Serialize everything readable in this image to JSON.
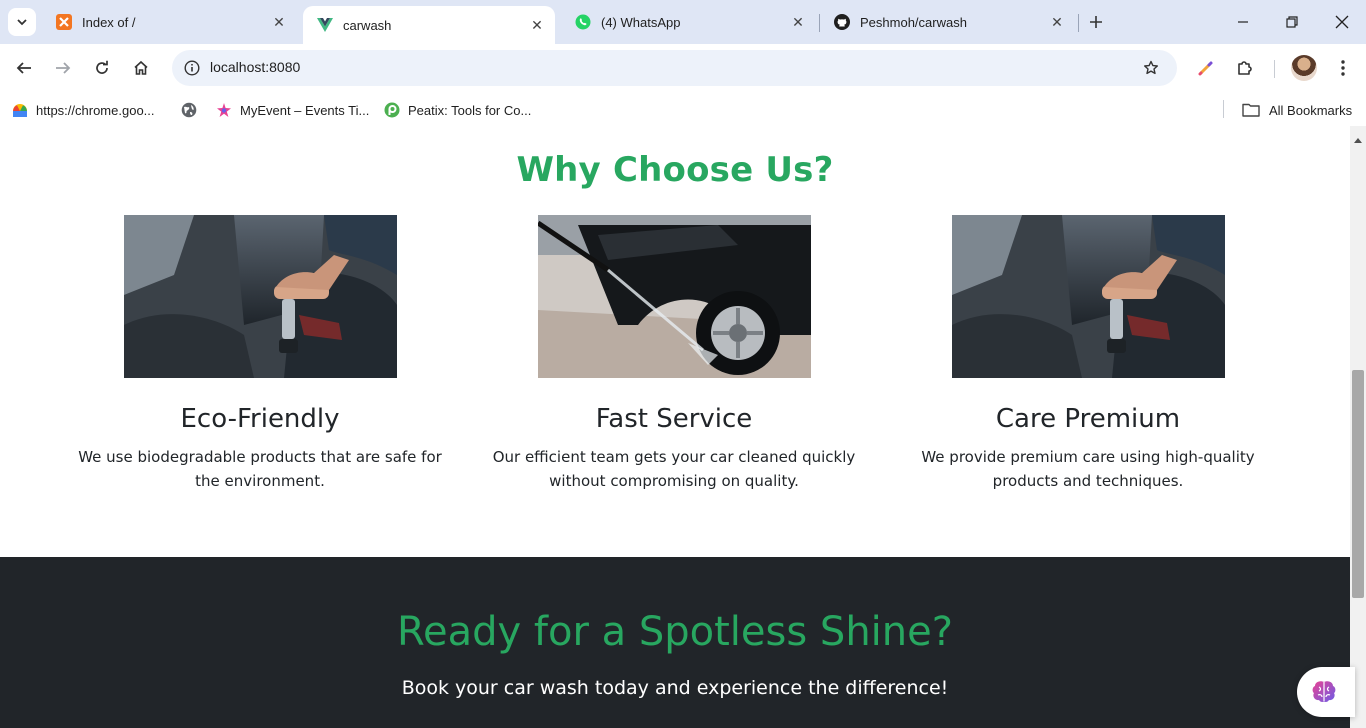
{
  "browser": {
    "tabs": [
      {
        "title": "Index of /",
        "icon": "xampp-icon",
        "active": false
      },
      {
        "title": "carwash",
        "icon": "vue-icon",
        "active": true
      },
      {
        "title": "(4) WhatsApp",
        "icon": "whatsapp-icon",
        "active": false
      },
      {
        "title": "Peshmoh/carwash",
        "icon": "github-icon",
        "active": false
      }
    ],
    "address": {
      "url": "localhost:8080"
    },
    "bookmarks": [
      {
        "label": "https://chrome.goo...",
        "icon": "chrome-web-store-icon"
      },
      {
        "label": "",
        "icon": "globe-icon"
      },
      {
        "label": "MyEvent – Events Ti...",
        "icon": "myevent-icon"
      },
      {
        "label": "Peatix: Tools for Co...",
        "icon": "peatix-icon"
      }
    ],
    "all_bookmarks_label": "All Bookmarks"
  },
  "page": {
    "why_title": "Why Choose Us?",
    "features": [
      {
        "title": "Eco-Friendly",
        "description": "We use biodegradable products that are safe for the environment.",
        "image": "interior-vacuum-photo"
      },
      {
        "title": "Fast Service",
        "description": "Our efficient team gets your car cleaned quickly without compromising on quality.",
        "image": "pressure-wash-wheel-photo"
      },
      {
        "title": "Care Premium",
        "description": "We provide premium care using high-quality products and techniques.",
        "image": "interior-vacuum-photo"
      }
    ],
    "cta": {
      "title": "Ready for a Spotless Shine?",
      "subtitle": "Book your car wash today and experience the difference!"
    }
  },
  "colors": {
    "accent_green": "#28a760",
    "dark_bg": "#212529",
    "tabstrip_bg": "#dfe6f5"
  }
}
